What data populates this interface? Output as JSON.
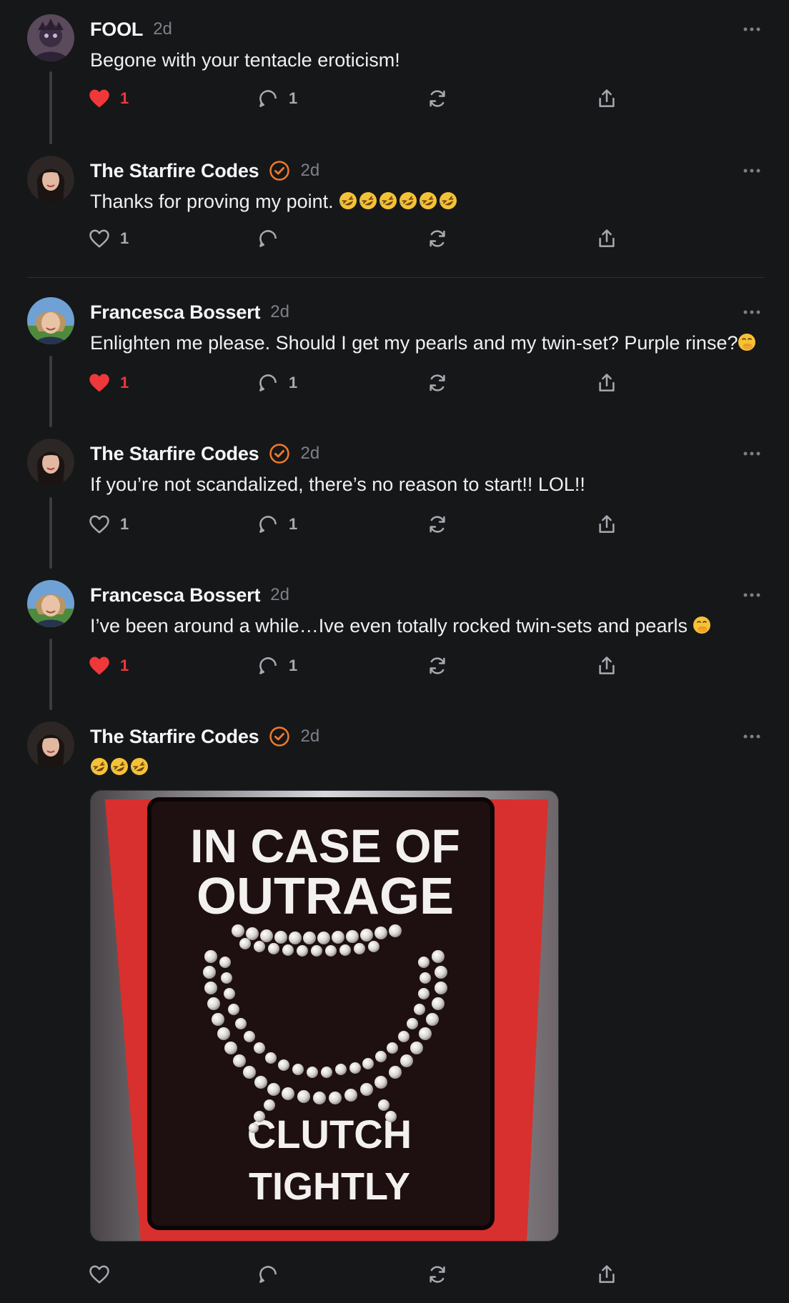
{
  "colors": {
    "background": "#161719",
    "like_active": "#f0383b",
    "verified": "#f07a2a",
    "muted_text": "#7d8087",
    "icon": "#a7aab0"
  },
  "posts": [
    {
      "author": "FOOL",
      "verified": false,
      "time": "2d",
      "text": "Begone with your tentacle eroticism!",
      "liked": true,
      "likes": "1",
      "replies": "1"
    },
    {
      "author": "The Starfire Codes",
      "verified": true,
      "time": "2d",
      "text": "Thanks for proving my point. ",
      "emoji": [
        "rolling-on-floor-laughing",
        "rolling-on-floor-laughing",
        "rolling-on-floor-laughing",
        "rolling-on-floor-laughing",
        "rolling-on-floor-laughing",
        "rolling-on-floor-laughing"
      ],
      "liked": false,
      "likes": "1",
      "replies": ""
    },
    {
      "author": "Francesca Bossert",
      "verified": false,
      "time": "2d",
      "text": "Enlighten me please. Should I get my pearls and my twin-set? Purple rinse?",
      "emoji": [
        "face-with-hand-over-mouth"
      ],
      "liked": true,
      "likes": "1",
      "replies": "1"
    },
    {
      "author": "The Starfire Codes",
      "verified": true,
      "time": "2d",
      "text": "If you’re not scandalized, there’s no reason to start!! LOL!!",
      "liked": false,
      "likes": "1",
      "replies": "1"
    },
    {
      "author": "Francesca Bossert",
      "verified": false,
      "time": "2d",
      "text": "I’ve been around a while…Ive even totally rocked twin-sets and pearls ",
      "emoji": [
        "face-with-hand-over-mouth"
      ],
      "liked": true,
      "likes": "1",
      "replies": "1"
    },
    {
      "author": "The Starfire Codes",
      "verified": true,
      "time": "2d",
      "text": "",
      "emoji": [
        "rolling-on-floor-laughing",
        "rolling-on-floor-laughing",
        "rolling-on-floor-laughing"
      ],
      "liked": false,
      "likes": "",
      "replies": "",
      "image": {
        "line1": "IN CASE OF",
        "line2": "OUTRAGE",
        "line3": "CLUTCH",
        "line4": "TIGHTLY"
      }
    }
  ]
}
